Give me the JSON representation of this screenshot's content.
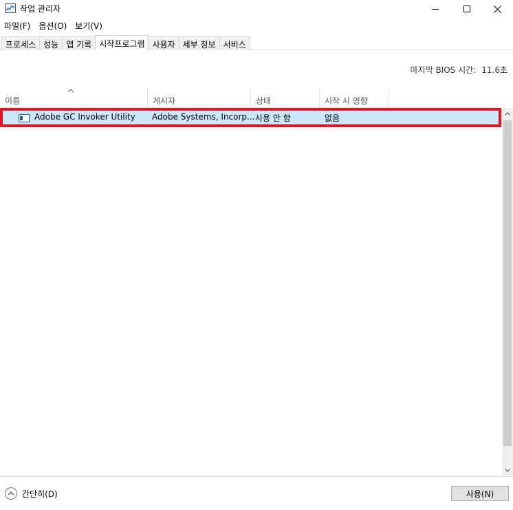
{
  "window": {
    "title": "작업 관리자",
    "icon": "task-manager-icon"
  },
  "menu": {
    "items": [
      "파일(F)",
      "옵션(O)",
      "보기(V)"
    ]
  },
  "tabs": {
    "items": [
      "프로세스",
      "성능",
      "앱 기록",
      "시작프로그램",
      "사용자",
      "세부 정보",
      "서비스"
    ],
    "active": "시작프로그램"
  },
  "bios": {
    "label": "마지막 BIOS 시간:",
    "value": "11.6초"
  },
  "columns": {
    "name": "이름",
    "publisher": "게시자",
    "status": "상태",
    "impact": "시작 시 영향",
    "sorted": "name"
  },
  "rows": [
    {
      "name": "Adobe GC Invoker Utility",
      "publisher": "Adobe Systems, Incorp...",
      "status": "사용 안 함",
      "impact": "없음",
      "icon": "application-icon",
      "selected": true,
      "highlighted": true
    }
  ],
  "footer": {
    "fewer_details": "간단히(D)",
    "enable_button": "사용(N)"
  },
  "colors": {
    "selection": "#cce8ff",
    "highlight_border": "#e81123"
  }
}
